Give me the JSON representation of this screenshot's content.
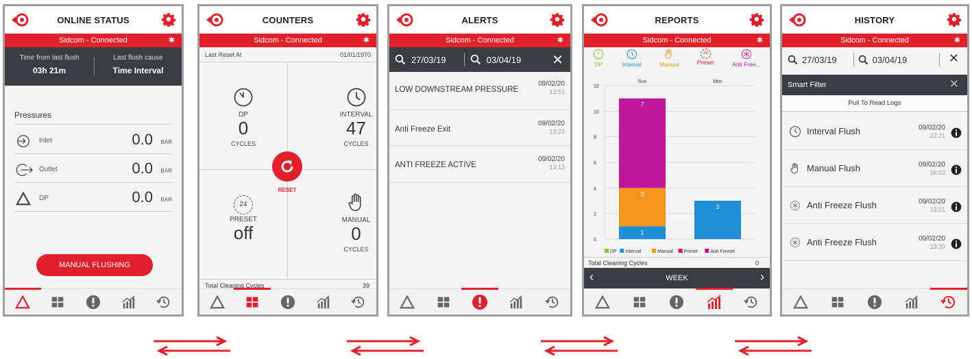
{
  "colors": {
    "accent": "#e0202a",
    "dark": "#3a3d40",
    "pink": "#c0169a",
    "orange": "#f7941d",
    "blue": "#1e8fd6",
    "green": "#8cc63f"
  },
  "connection": "Sidcom - Connected",
  "screen1": {
    "title": "ONLINE STATUS",
    "time_label": "Time from last flush",
    "time_value": "03h 21m",
    "cause_label": "Last flush cause",
    "cause_value": "Time Interval",
    "pressures_title": "Pressures",
    "rows": [
      {
        "label": "Inlet",
        "value": "0.0",
        "unit": "BAR",
        "icon": "inlet-icon"
      },
      {
        "label": "Outlet",
        "value": "0.0",
        "unit": "BAR",
        "icon": "outlet-icon"
      },
      {
        "label": "DP",
        "value": "0.0",
        "unit": "BAR",
        "icon": "triangle-icon"
      }
    ],
    "button": "MANUAL FLUSHING"
  },
  "screen2": {
    "title": "COUNTERS",
    "reset_label": "Last Reset At",
    "reset_date": "01/01/1970",
    "dp": {
      "label": "DP",
      "value": "0",
      "unit": "CYCLES"
    },
    "interval": {
      "label": "INTERVAL",
      "value": "47",
      "unit": "CYCLES"
    },
    "preset": {
      "label": "PRESET",
      "value": "off"
    },
    "manual": {
      "label": "MANUAL",
      "value": "0",
      "unit": "CYCLES"
    },
    "reset_button": "RESET",
    "total_label": "Total Cleaning Cycles",
    "total_value": "39"
  },
  "screen3": {
    "title": "ALERTS",
    "from": "27/03/19",
    "to": "03/04/19",
    "alerts": [
      {
        "text": "LOW DOWNSTREAM PRESSURE",
        "date": "09/02/20",
        "time": "13:51"
      },
      {
        "text": "Anti Freeze Exit",
        "date": "09/02/20",
        "time": "13:22"
      },
      {
        "text": "ANTI FREEZE ACTIVE",
        "date": "09/02/20",
        "time": "13:13"
      }
    ]
  },
  "screen4": {
    "title": "REPORTS",
    "filters": [
      "DP",
      "Interval",
      "Manual",
      "Preset",
      "Anti Free..."
    ],
    "total_label": "Total Cleaning Cycles",
    "total_value": "0",
    "period": "WEEK"
  },
  "chart_data": {
    "type": "bar",
    "stacked": true,
    "categories": [
      "Sun",
      "Mon"
    ],
    "series": [
      {
        "name": "DP",
        "values": [
          0,
          0
        ]
      },
      {
        "name": "Interval",
        "values": [
          1,
          3
        ]
      },
      {
        "name": "Manual",
        "values": [
          3,
          0
        ]
      },
      {
        "name": "Preset",
        "values": [
          0,
          0
        ]
      },
      {
        "name": "Anti Freeze",
        "values": [
          7,
          0
        ]
      }
    ],
    "ylim": [
      0,
      12
    ],
    "yticks": [
      "0",
      "2",
      "4",
      "6",
      "8",
      "10",
      "12"
    ],
    "grid": true,
    "legend": "bottom"
  },
  "screen5": {
    "title": "HISTORY",
    "from": "27/03/19",
    "to": "03/04/19",
    "smart_filter": "Smart Filter",
    "pull": "Pull To Read Logs",
    "items": [
      {
        "text": "Interval Flush",
        "date": "09/02/20",
        "time": "22:21",
        "icon": "clock-icon"
      },
      {
        "text": "Manual Flush",
        "date": "09/02/20",
        "time": "16:03",
        "icon": "hand-icon"
      },
      {
        "text": "Anti Freeze Flush",
        "date": "09/02/20",
        "time": "13:21",
        "icon": "snowflake-icon"
      },
      {
        "text": "Anti Freeze Flush",
        "date": "09/02/20",
        "time": "13:20",
        "icon": "snowflake-icon"
      }
    ]
  }
}
